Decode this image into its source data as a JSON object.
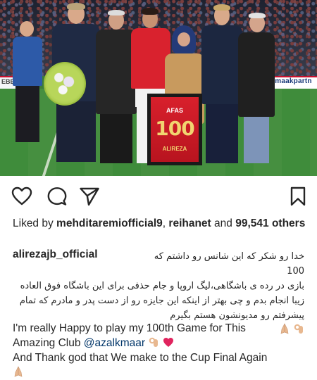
{
  "photo": {
    "ad_left": "EBE",
    "ad_right": "nmaakpartn",
    "frame": {
      "brand": "AFAS",
      "number": "100",
      "name": "ALIREZA"
    }
  },
  "actions": {
    "like_icon": "heart-outline-icon",
    "comment_icon": "comment-bubble-icon",
    "share_icon": "paper-plane-icon",
    "save_icon": "bookmark-outline-icon"
  },
  "likes": {
    "prefix": "Liked by ",
    "user1": "mehditaremiofficial9",
    "sep": ", ",
    "user2": "reihanet",
    "mid": " and ",
    "count": "99,541",
    "suffix": " others"
  },
  "caption": {
    "username": "alirezajb_official",
    "persian_line1": "خدا رو شکر که این شانس رو داشتم که 100",
    "persian_rest": "بازی در رده ی باشگاهی،لیگ اروپا و جام حذفی برای این باشگاه فوق العاده زیبا انجام بدم و چی بهتر از اینکه این جایزه رو از دست پدر و مادرم که تمام پیشرفتم رو مدیونشون هستم بگیرم",
    "en_line1": "I'm really Happy to play my 100th Game for This",
    "en_line2_pre": "Amazing Club ",
    "en_mention": "@azalkmaar",
    "en_line3": "And Thank god that We make to  the Cup Final Again"
  },
  "colors": {
    "text": "#262626",
    "mention": "#003569",
    "heart": "#e0245e"
  }
}
